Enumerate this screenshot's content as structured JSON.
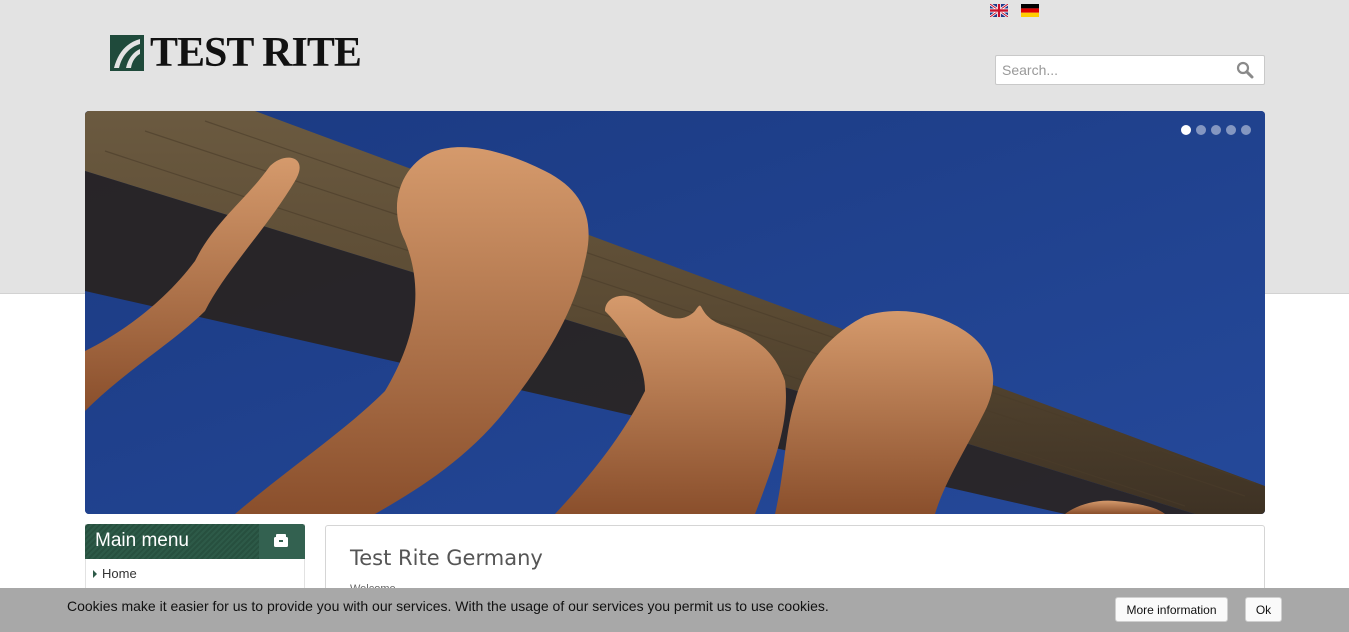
{
  "header": {
    "logo_text": "TEST RITE",
    "languages": [
      {
        "name": "english-flag-icon"
      },
      {
        "name": "german-flag-icon"
      }
    ],
    "search": {
      "placeholder": "Search...",
      "value": ""
    }
  },
  "slider": {
    "slide_count": 5,
    "active_index": 0
  },
  "sidebar": {
    "title": "Main menu",
    "items": [
      {
        "label": "Home"
      }
    ]
  },
  "main": {
    "title": "Test Rite Germany",
    "subtitle": "Welcome"
  },
  "cookie": {
    "message": "Cookies make it easier for us to provide you with our services. With the usage of our services you permit us to use cookies.",
    "more_label": "More information",
    "ok_label": "Ok"
  },
  "colors": {
    "brand_green": "#2d5a48",
    "sky_blue": "#1e3f88",
    "header_bg": "#e3e3e3",
    "cookie_bg": "#a8a8a8"
  }
}
